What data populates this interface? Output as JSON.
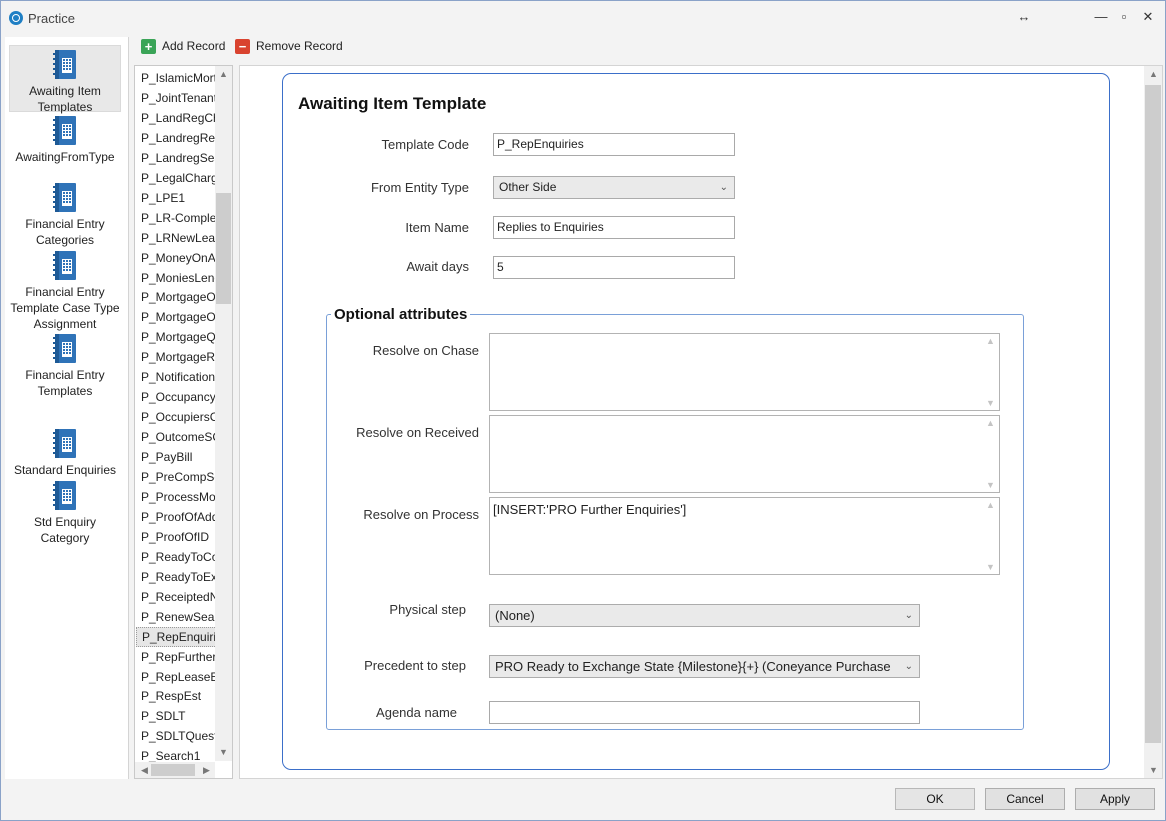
{
  "window": {
    "title": "Practice",
    "resize_glyph": "↔",
    "minimize_glyph": "—",
    "maximize_glyph": "▫",
    "close_glyph": "✕"
  },
  "sidebar": {
    "items": [
      {
        "label": "Awaiting Item Templates",
        "icon": "book-icon",
        "selected": true
      },
      {
        "label": "AwaitingFromType",
        "icon": "book-icon"
      },
      {
        "label": "Financial Entry Categories",
        "icon": "book-icon"
      },
      {
        "label": "Financial Entry Template Case Type Assignment",
        "icon": "book-icon"
      },
      {
        "label": "Financial Entry Templates",
        "icon": "book-icon"
      },
      {
        "label": "Standard Enquiries",
        "icon": "book-icon"
      },
      {
        "label": "Std Enquiry Category",
        "icon": "book-icon"
      }
    ]
  },
  "toolbar": {
    "add_label": "Add Record",
    "remove_label": "Remove Record",
    "add_icon": "+",
    "remove_icon": "−",
    "add_color": "#3aa457",
    "remove_color": "#d9432f"
  },
  "records": {
    "items": [
      "P_IslamicMort",
      "P_JointTenants",
      "P_LandRegCha",
      "P_LandregReg",
      "P_LandregSea",
      "P_LegalCharge",
      "P_LPE1",
      "P_LR-Complet",
      "P_LRNewLease",
      "P_MoneyOnAc",
      "P_MoniesLenc",
      "P_MortgageO",
      "P_MortgageO",
      "P_MortgageQ",
      "P_MortgageRe",
      "P_Notification",
      "P_OccupancyD",
      "P_OccupiersCo",
      "P_OutcomeSC",
      "P_PayBill",
      "P_PreCompSe",
      "P_ProcessMor",
      "P_ProofOfAdd",
      "P_ProofOfID",
      "P_ReadyToCor",
      "P_ReadyToExc",
      "P_ReceiptedN",
      "P_RenewSearc",
      "P_RepEnquirie",
      "P_RepFurtherE",
      "P_RepLeaseEn",
      "P_RespEst",
      "P_SDLT",
      "P_SDLTQuesti",
      "P_Search1"
    ],
    "selected_index": 28
  },
  "form": {
    "title": "Awaiting Item Template",
    "template_code_label": "Template Code",
    "template_code_value": "P_RepEnquiries",
    "from_entity_label": "From Entity Type",
    "from_entity_value": "Other Side",
    "item_name_label": "Item Name",
    "item_name_value": "Replies to Enquiries",
    "await_days_label": "Await days",
    "await_days_value": "5",
    "optional": {
      "title": "Optional attributes",
      "resolve_chase_label": "Resolve on Chase",
      "resolve_chase_value": "",
      "resolve_received_label": "Resolve on Received",
      "resolve_received_value": "",
      "resolve_process_label": "Resolve on Process",
      "resolve_process_value": "[INSERT:'PRO Further Enquiries']",
      "physical_step_label": "Physical step",
      "physical_step_value": "(None)",
      "precedent_label": "Precedent to step",
      "precedent_value": "PRO Ready to Exchange State {Milestone}{+} (Coneyance Purchase",
      "agenda_label": "Agenda name",
      "agenda_value": ""
    }
  },
  "footer": {
    "ok_label": "OK",
    "cancel_label": "Cancel",
    "apply_label": "Apply"
  },
  "colors": {
    "accent_border": "#3b6fc9",
    "group_border": "#7aa0d8",
    "icon_blue": "#2f73b8"
  }
}
